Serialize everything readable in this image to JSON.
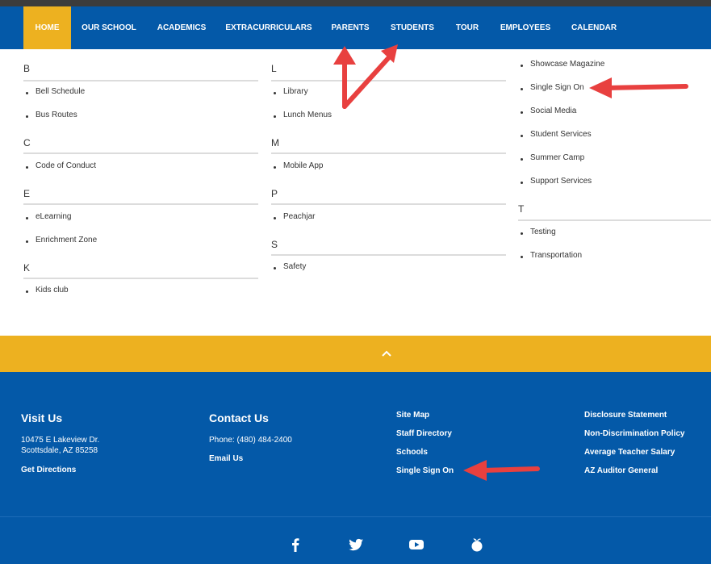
{
  "nav": {
    "items": [
      {
        "label": "HOME",
        "active": true
      },
      {
        "label": "OUR SCHOOL"
      },
      {
        "label": "ACADEMICS"
      },
      {
        "label": "EXTRACURRICULARS"
      },
      {
        "label": "PARENTS"
      },
      {
        "label": "STUDENTS"
      },
      {
        "label": "TOUR"
      },
      {
        "label": "EMPLOYEES"
      },
      {
        "label": "CALENDAR"
      }
    ]
  },
  "directory": {
    "col1": [
      {
        "letter": "B",
        "links": [
          "Bell Schedule",
          "Bus Routes"
        ]
      },
      {
        "letter": "C",
        "links": [
          "Code of Conduct"
        ]
      },
      {
        "letter": "E",
        "links": [
          "eLearning",
          "Enrichment Zone"
        ]
      },
      {
        "letter": "K",
        "links": [
          "Kids club"
        ]
      }
    ],
    "col2": [
      {
        "letter": "L",
        "links": [
          "Library",
          "Lunch Menus"
        ]
      },
      {
        "letter": "M",
        "links": [
          "Mobile App"
        ]
      },
      {
        "letter": "P",
        "links": [
          "Peachjar"
        ]
      },
      {
        "letter": "S",
        "links": [
          "Safety"
        ]
      }
    ],
    "col3_top_links": [
      "Showcase Magazine",
      "Single Sign On",
      "Social Media",
      "Student Services",
      "Summer Camp",
      "Support Services"
    ],
    "col3": [
      {
        "letter": "T",
        "links": [
          "Testing",
          "Transportation"
        ]
      }
    ]
  },
  "footer": {
    "visit": {
      "heading": "Visit Us",
      "address_line1": "10475 E Lakeview Dr.",
      "address_line2": "Scottsdale, AZ 85258",
      "directions": "Get Directions"
    },
    "contact": {
      "heading": "Contact Us",
      "phone": "Phone: (480) 484-2400",
      "email": "Email Us"
    },
    "links_col1": [
      "Site Map",
      "Staff Directory",
      "Schools",
      "Single Sign On"
    ],
    "links_col2": [
      "Disclosure Statement",
      "Non-Discrimination Policy",
      "Average Teacher Salary",
      "AZ Auditor General"
    ]
  },
  "social": [
    "facebook-icon",
    "twitter-icon",
    "youtube-icon",
    "peachjar-icon"
  ],
  "colors": {
    "brand_blue": "#0459a8",
    "accent_gold": "#edb120",
    "annotation_red": "#e8403f"
  }
}
